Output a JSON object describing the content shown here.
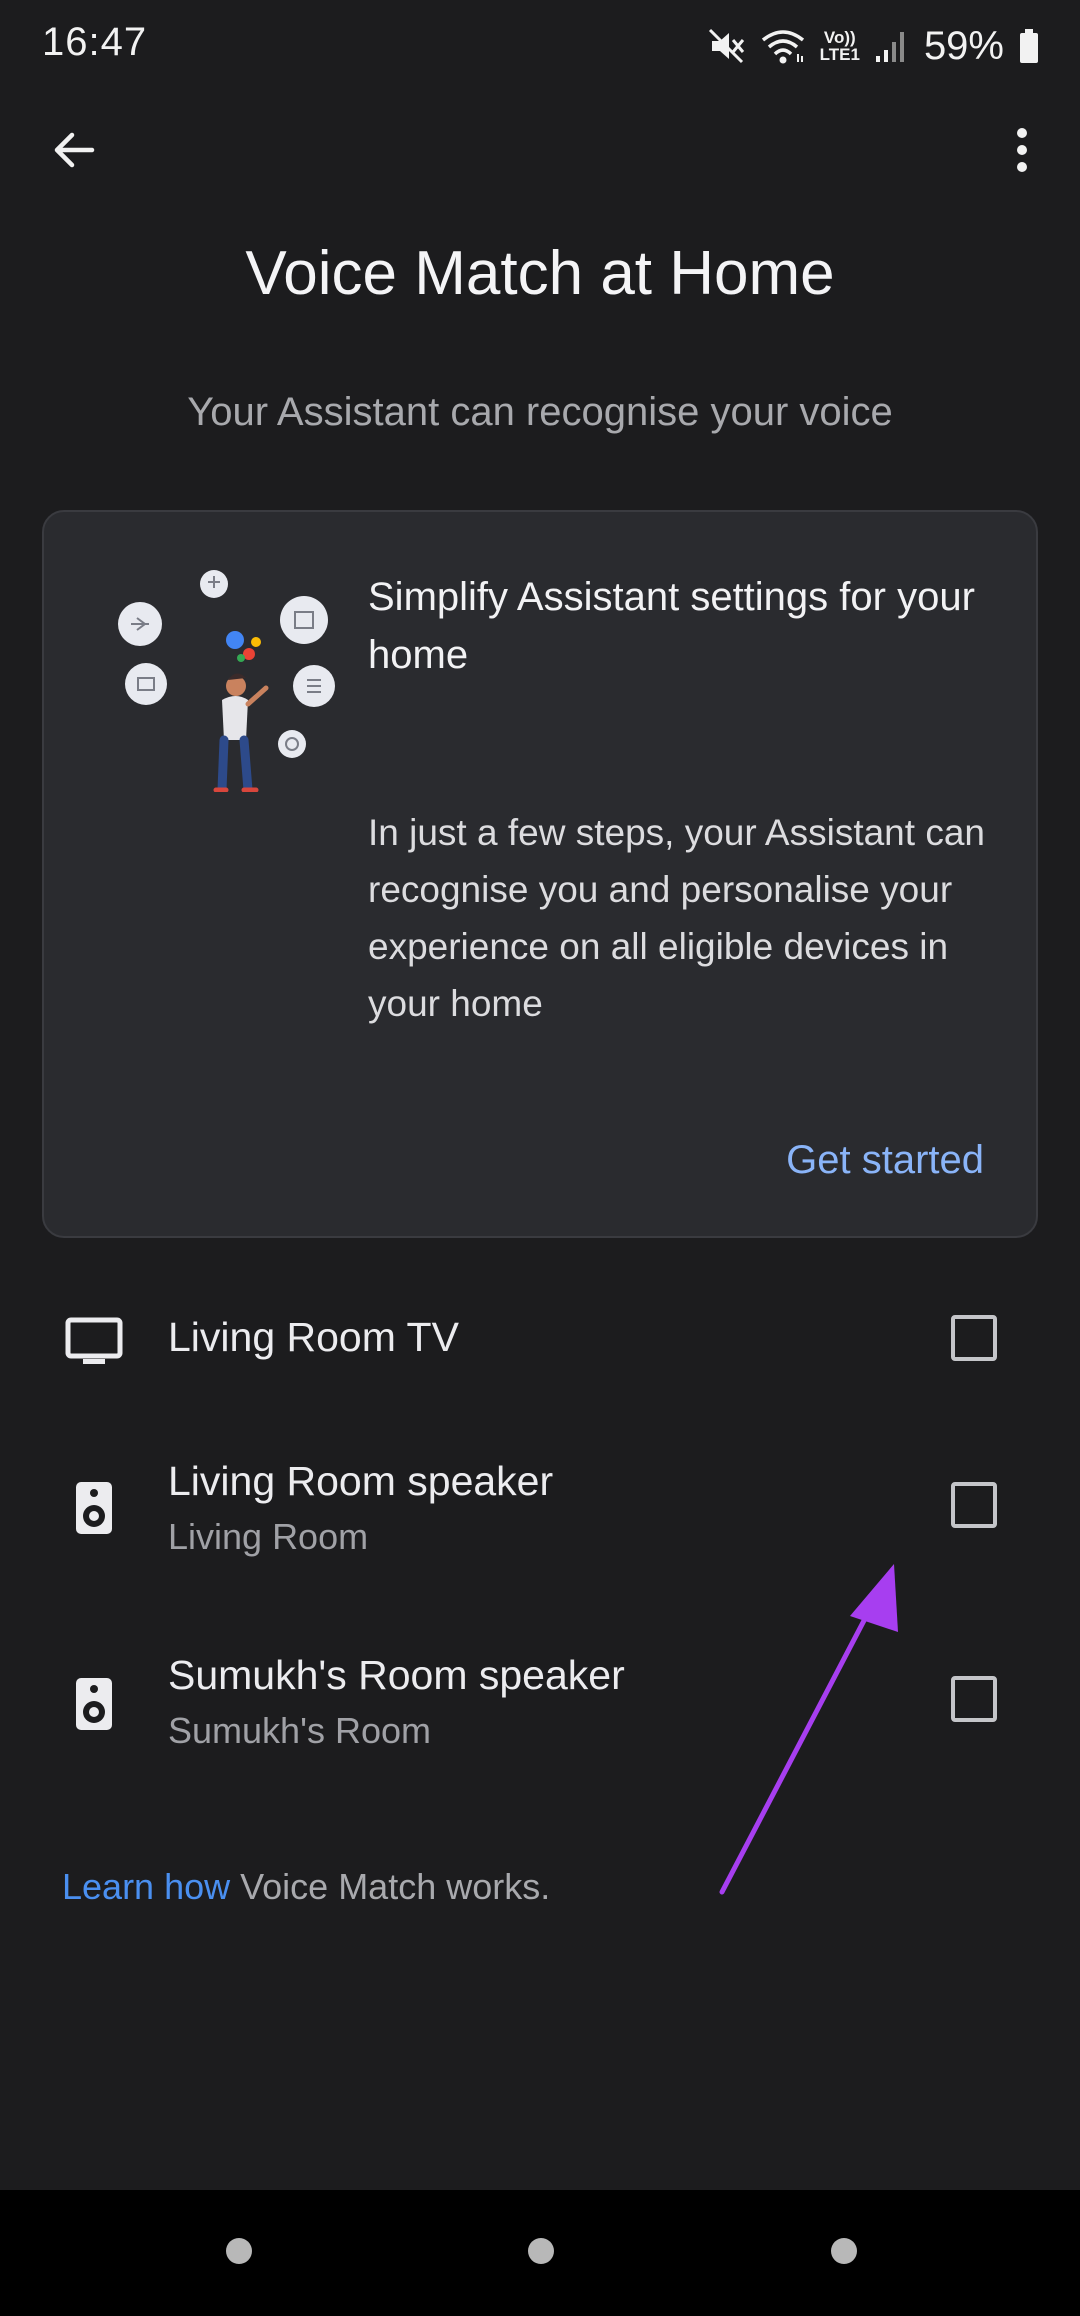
{
  "status_bar": {
    "time": "16:47",
    "battery_percent": "59%",
    "network_label_top": "Vo))",
    "network_label_bottom": "LTE1"
  },
  "toolbar": {
    "back_icon": "arrow-back-icon",
    "more_icon": "more-vert-icon"
  },
  "page": {
    "title": "Voice Match at Home",
    "subtitle": "Your Assistant can recognise your voice"
  },
  "card": {
    "title": "Simplify Assistant settings for your home",
    "body": "In just a few steps, your Assistant can recognise you and personalise your experience on all eligible devices in your home",
    "action_label": "Get started"
  },
  "devices": [
    {
      "name": "Living Room TV",
      "room": "",
      "icon": "tv-icon",
      "checked": false
    },
    {
      "name": "Living Room speaker",
      "room": "Living Room",
      "icon": "speaker-icon",
      "checked": false
    },
    {
      "name": "Sumukh's Room speaker",
      "room": "Sumukh's Room",
      "icon": "speaker-icon",
      "checked": false
    }
  ],
  "footer": {
    "learn_link": "Learn how",
    "learn_rest": " Voice Match works."
  },
  "colors": {
    "background": "#1c1c1e",
    "card": "#2a2b2f",
    "accent_link": "#8ab4f8",
    "learn_link": "#4a8ff0",
    "annotation_arrow": "#a73ef0"
  }
}
